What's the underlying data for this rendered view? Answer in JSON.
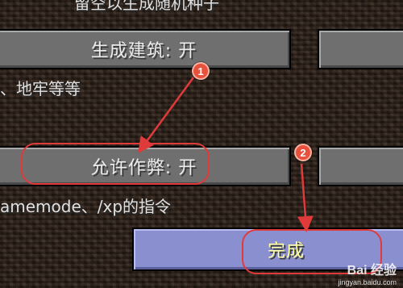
{
  "top_hint": "留空以生成随机种子",
  "structures_button": {
    "label": "生成建筑: 开"
  },
  "structures_hint": "、地牢等等",
  "cheats_button": {
    "label": "允许作弊: 开"
  },
  "cheats_hint": "amemode、/xp的指令",
  "done_button": {
    "label": "完成"
  },
  "markers": [
    "1",
    "2"
  ],
  "watermark": {
    "logo": "Bai 经验",
    "url": "jingyan.baidu.com"
  },
  "colors": {
    "annotation_red": "#e03a3a",
    "marker_fill": "#e8523c",
    "selected_button": "#8a8fd0"
  }
}
